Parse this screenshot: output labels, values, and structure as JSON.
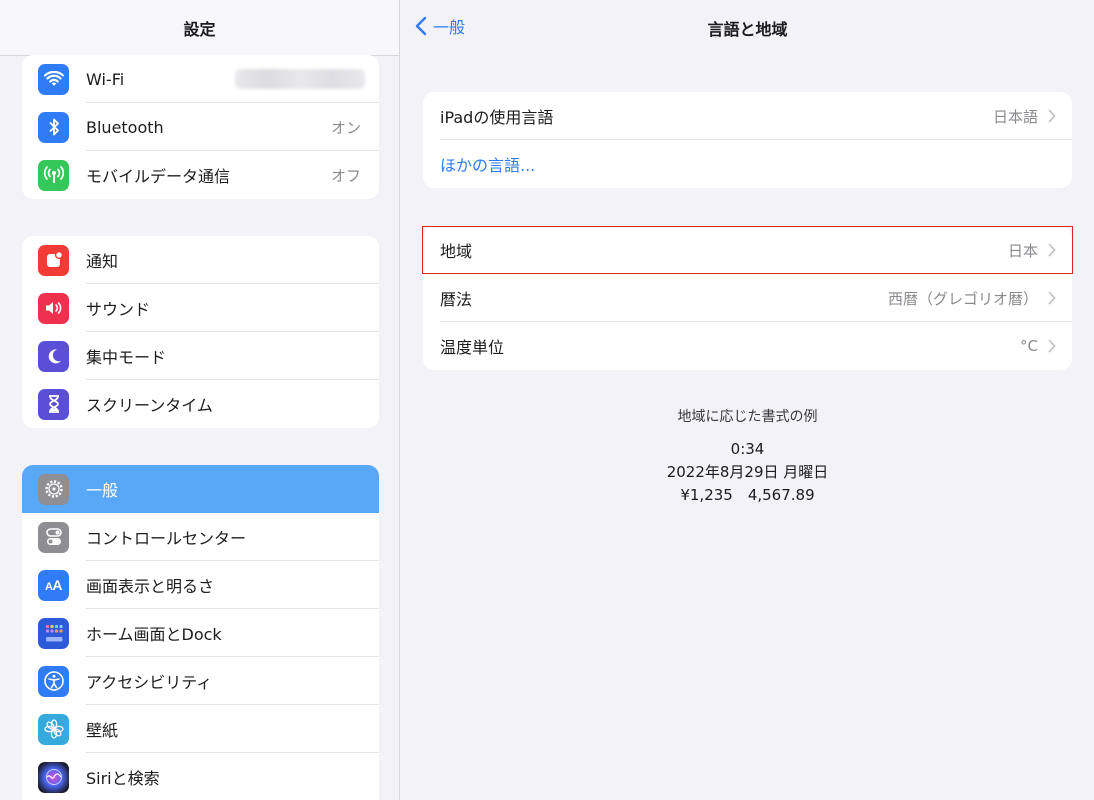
{
  "sidebar": {
    "title": "設定",
    "group1": [
      {
        "label": "Wi-Fi",
        "value": "",
        "icon": "wifi-icon",
        "color": "#2f7cf6"
      },
      {
        "label": "Bluetooth",
        "value": "オン",
        "icon": "bluetooth-icon",
        "color": "#2f7cf6"
      },
      {
        "label": "モバイルデータ通信",
        "value": "オフ",
        "icon": "cellular-icon",
        "color": "#34c759"
      }
    ],
    "group2": [
      {
        "label": "通知",
        "icon": "notification-icon",
        "color": "#f23b35"
      },
      {
        "label": "サウンド",
        "icon": "sound-icon",
        "color": "#f0304f"
      },
      {
        "label": "集中モード",
        "icon": "moon-icon",
        "color": "#5a4fd6"
      },
      {
        "label": "スクリーンタイム",
        "icon": "hourglass-icon",
        "color": "#5a4fd6"
      }
    ],
    "group3": [
      {
        "label": "一般",
        "icon": "gear-icon",
        "color": "#8e8e93",
        "selected": true
      },
      {
        "label": "コントロールセンター",
        "icon": "toggles-icon",
        "color": "#8e8e93"
      },
      {
        "label": "画面表示と明るさ",
        "icon": "text-size-icon",
        "color": "#2f7cf6"
      },
      {
        "label": "ホーム画面とDock",
        "icon": "home-grid-icon",
        "color": "#2d5ad8"
      },
      {
        "label": "アクセシビリティ",
        "icon": "accessibility-icon",
        "color": "#2f7cf6"
      },
      {
        "label": "壁紙",
        "icon": "flower-icon",
        "color": "#36aadc"
      },
      {
        "label": "Siriと検索",
        "icon": "siri-icon",
        "color": "#222"
      }
    ],
    "selected_color": "#59a8f8"
  },
  "nav": {
    "back_label": "一般",
    "title": "言語と地域"
  },
  "language_group": [
    {
      "label": "iPadの使用言語",
      "value": "日本語"
    },
    {
      "label": "ほかの言語...",
      "value": ""
    }
  ],
  "region_group": [
    {
      "label": "地域",
      "value": "日本",
      "highlighted": true
    },
    {
      "label": "暦法",
      "value": "西暦（グレゴリオ暦）"
    },
    {
      "label": "温度単位",
      "value": "°C"
    }
  ],
  "example": {
    "title": "地域に応じた書式の例",
    "time": "0:34",
    "date": "2022年8月29日 月曜日",
    "numbers": "¥1,235　4,567.89"
  },
  "colors": {
    "accent": "#2f7cf6",
    "highlight_border": "#d62828"
  }
}
